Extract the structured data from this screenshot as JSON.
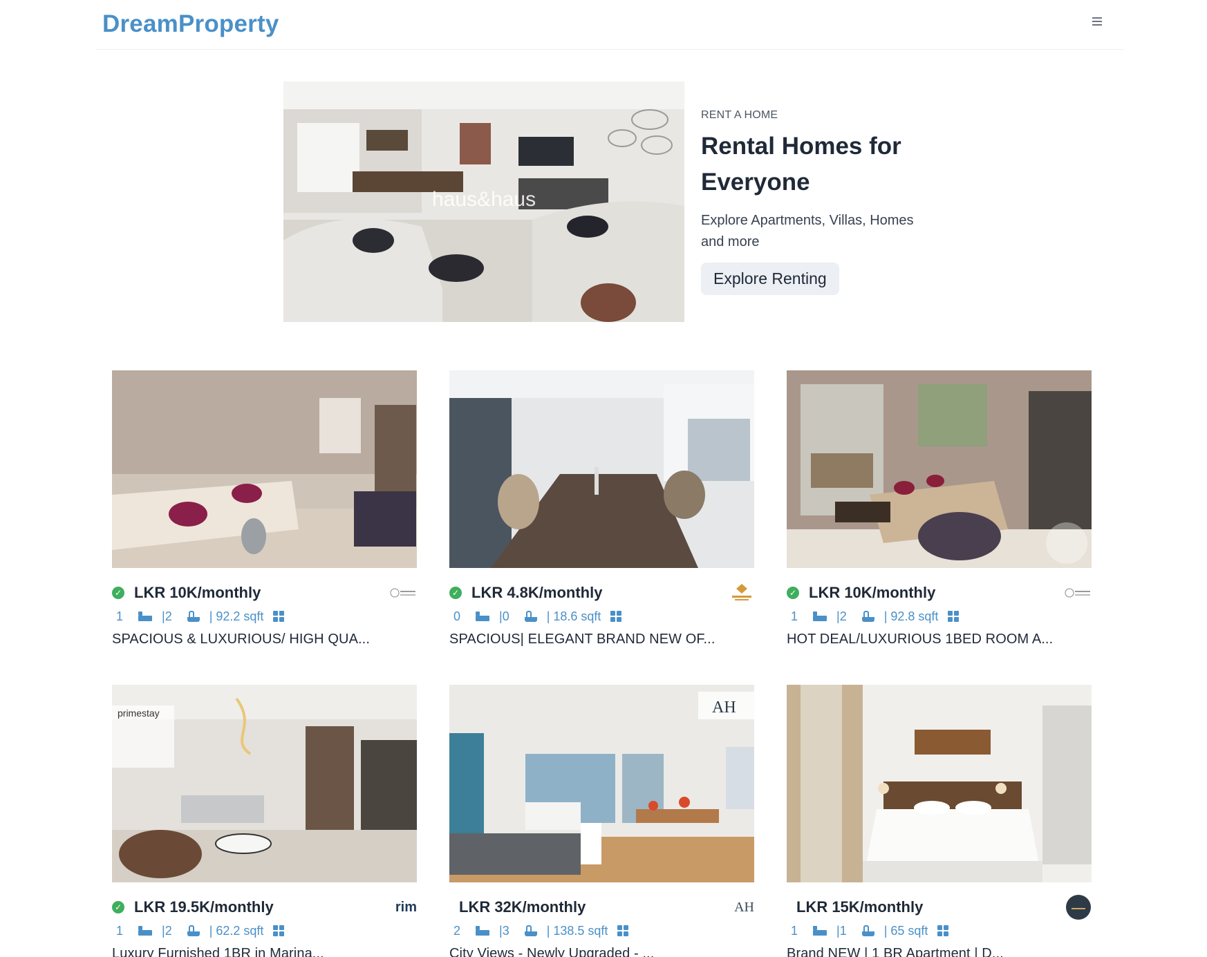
{
  "header": {
    "brand": "DreamProperty"
  },
  "hero": {
    "watermark": "haus&haus",
    "eyebrow": "RENT A HOME",
    "title": "Rental Homes for Everyone",
    "subtitle": "Explore Apartments, Villas, Homes and more",
    "button": "Explore Renting"
  },
  "listings": [
    {
      "price": "LKR 10K/monthly",
      "verified": true,
      "beds": "1",
      "baths": "|2",
      "area": "| 92.2 sqft",
      "title": "SPACIOUS & LUXURIOUS/ HIGH QUA..."
    },
    {
      "price": "LKR 4.8K/monthly",
      "verified": true,
      "beds": "0",
      "baths": "|0",
      "area": "| 18.6 sqft",
      "title": "SPACIOUS| ELEGANT BRAND NEW OF..."
    },
    {
      "price": "LKR 10K/monthly",
      "verified": true,
      "beds": "1",
      "baths": "|2",
      "area": "| 92.8 sqft",
      "title": "HOT DEAL/LUXURIOUS 1BED ROOM A..."
    },
    {
      "price": "LKR 19.5K/monthly",
      "verified": true,
      "beds": "1",
      "baths": "|2",
      "area": "| 62.2 sqft",
      "title": "Luxury Furnished 1BR in Marina...",
      "agency_text": "rim",
      "watermark": "primestay"
    },
    {
      "price": "LKR 32K/monthly",
      "verified": false,
      "beds": "2",
      "baths": "|3",
      "area": "| 138.5 sqft",
      "title": "City Views - Newly Upgraded - ...",
      "agency_text": "AH",
      "watermark": "AH"
    },
    {
      "price": "LKR 15K/monthly",
      "verified": false,
      "beds": "1",
      "baths": "|1",
      "area": "| 65 sqft",
      "title": "Brand NEW | 1 BR Apartment | D..."
    }
  ],
  "colors": {
    "brand": "#4a90c8",
    "verified": "#3fae5d",
    "button_bg": "#eceff3"
  }
}
